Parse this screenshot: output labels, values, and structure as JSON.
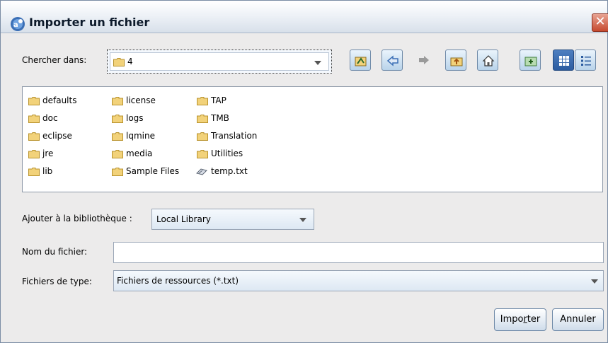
{
  "window": {
    "title": "Importer un fichier",
    "close_glyph": "✕"
  },
  "lookin": {
    "label": "Chercher dans:",
    "value": "4"
  },
  "toolbar": {
    "icons": [
      "recent-icon",
      "back-arrow-icon",
      "forward-arrow-icon",
      "up-folder-icon",
      "home-icon",
      "new-folder-icon",
      "list-view-icon",
      "details-view-icon"
    ]
  },
  "files": {
    "col1": [
      "defaults",
      "doc",
      "eclipse",
      "jre",
      "lib"
    ],
    "col2": [
      "license",
      "logs",
      "lqmine",
      "media",
      "Sample Files"
    ],
    "col3": [
      "TAP",
      "TMB",
      "Translation",
      "Utilities"
    ],
    "file": "temp.txt"
  },
  "library": {
    "label": "Ajouter à la bibliothèque :",
    "value": "Local Library"
  },
  "filename": {
    "label": "Nom du fichier:",
    "value": ""
  },
  "filetype": {
    "label": "Fichiers de type:",
    "value": "Fichiers de ressources (*.txt)"
  },
  "buttons": {
    "import_pre": "Impo",
    "import_u": "r",
    "import_post": "ter",
    "cancel": "Annuler"
  },
  "colors": {
    "folder": "#f2d27a",
    "folder_edge": "#b8922c",
    "accent": "#3b6fb6"
  }
}
